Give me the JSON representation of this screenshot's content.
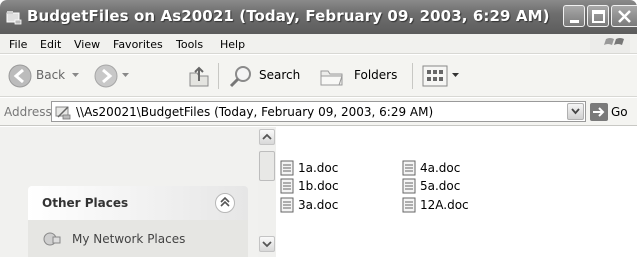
{
  "window": {
    "title": "BudgetFiles on As20021 (Today, February 09, 2003, 6:29 AM)"
  },
  "menu": {
    "items": [
      "File",
      "Edit",
      "View",
      "Favorites",
      "Tools",
      "Help"
    ]
  },
  "toolbar": {
    "back_label": "Back",
    "search_label": "Search",
    "folders_label": "Folders"
  },
  "address": {
    "label": "Address",
    "value": "\\\\As20021\\BudgetFiles (Today, February 09, 2003, 6:29 AM)",
    "go_label": "Go"
  },
  "taskpane": {
    "section_title": "Other Places",
    "links": [
      "My Network Places"
    ]
  },
  "files": [
    {
      "name": "1a.doc"
    },
    {
      "name": "1b.doc"
    },
    {
      "name": "3a.doc"
    },
    {
      "name": "4a.doc"
    },
    {
      "name": "5a.doc"
    },
    {
      "name": "12A.doc"
    }
  ]
}
